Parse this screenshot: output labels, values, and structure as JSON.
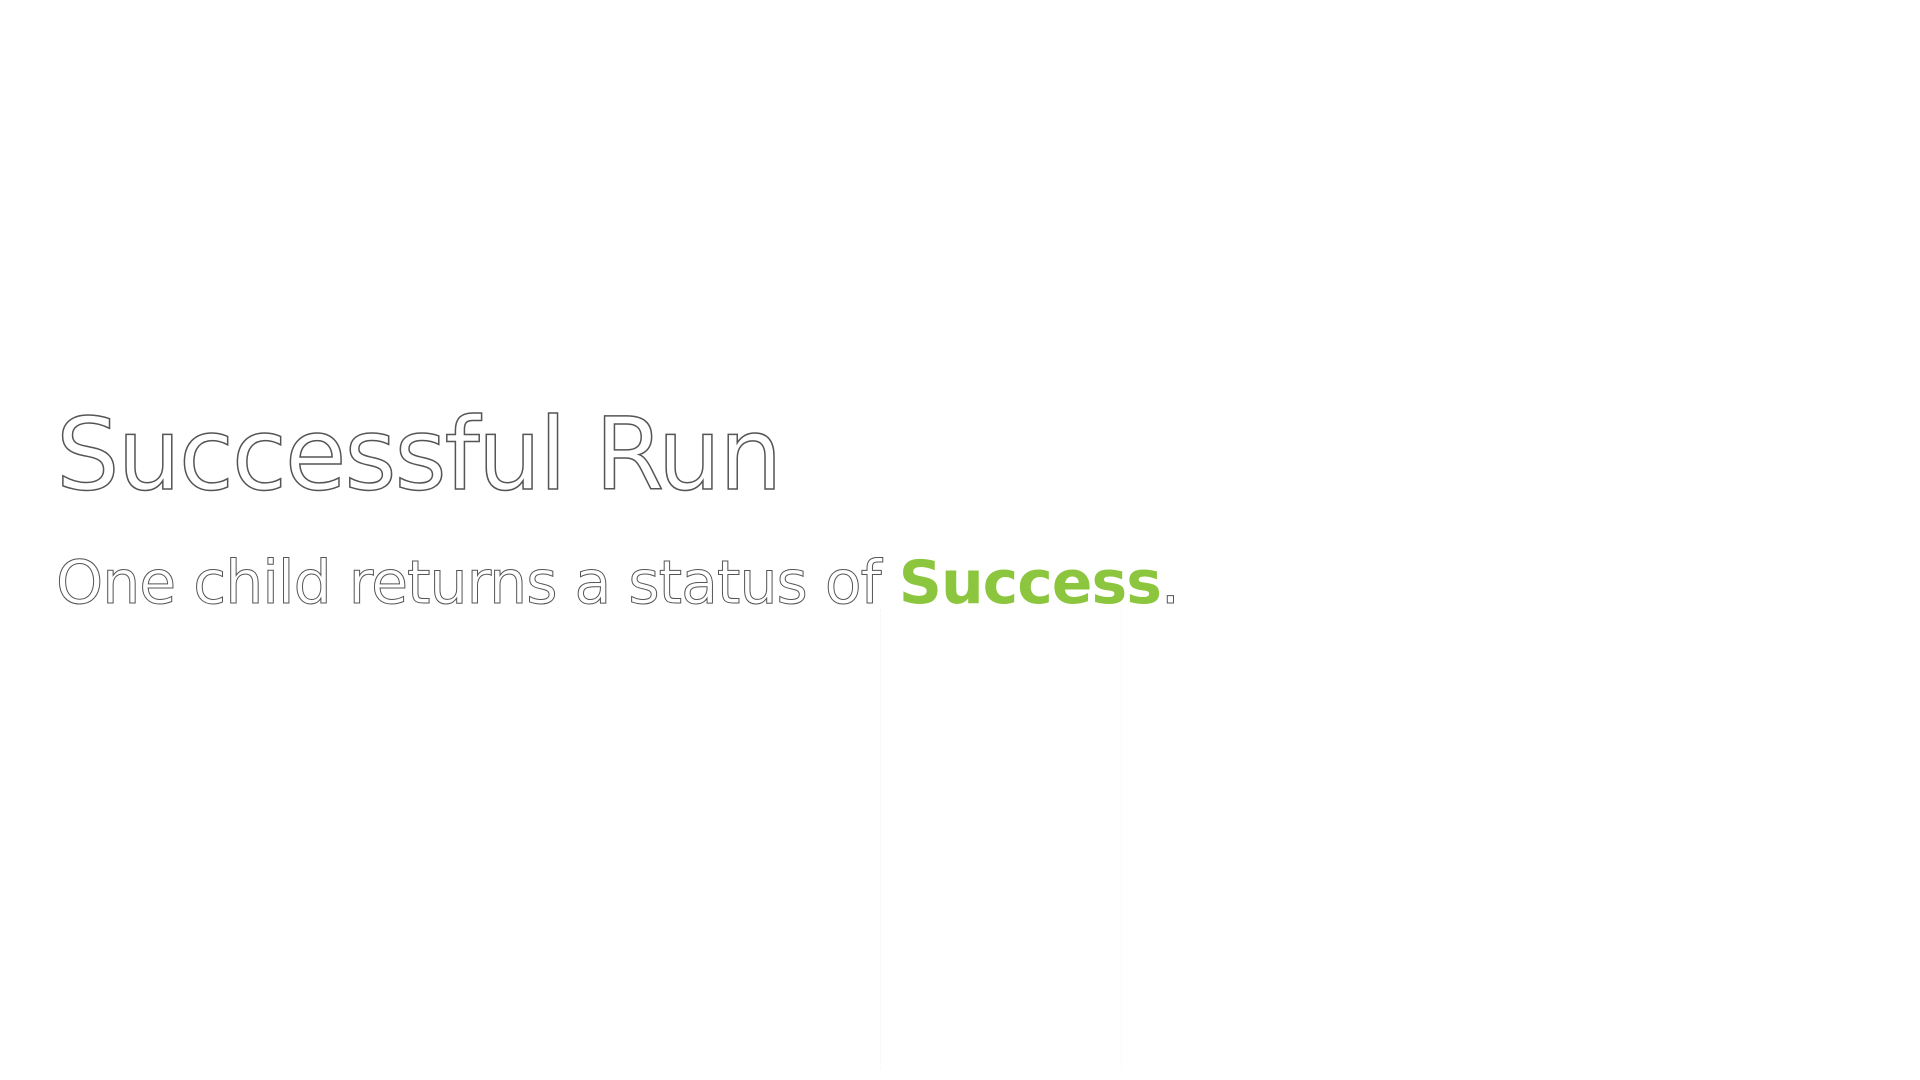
{
  "slide": {
    "title": "Successful Run",
    "subtitle_prefix": "One child returns a status of ",
    "subtitle_highlight": "Success",
    "subtitle_suffix": "."
  },
  "colors": {
    "background": "#ffffff",
    "text_fill": "#ffffff",
    "text_outline": "#555555",
    "success": "#8cc63f"
  }
}
